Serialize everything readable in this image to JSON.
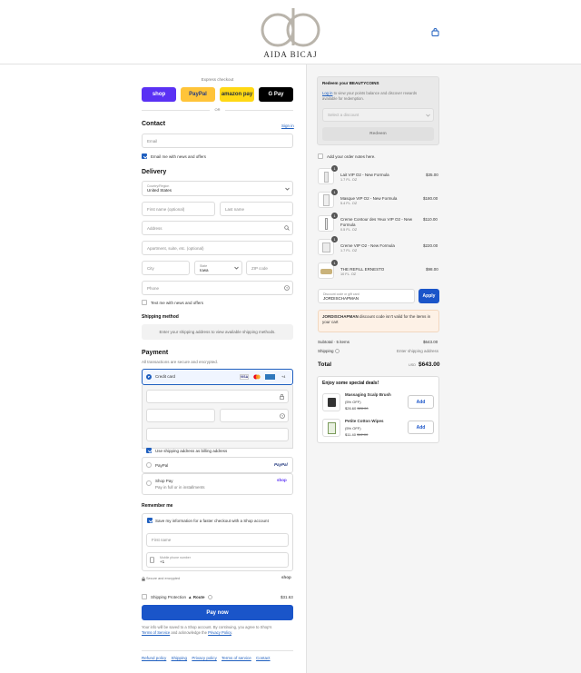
{
  "brand": {
    "name": "AIDA BICAJ"
  },
  "express": {
    "label": "Express checkout",
    "buttons": [
      {
        "name": "shop-pay",
        "label": "shop",
        "bg": "#5a31f4",
        "fg": "#ffffff"
      },
      {
        "name": "paypal",
        "label": "PayPal",
        "bg": "#ffc439",
        "fg": "#253b80"
      },
      {
        "name": "amazon-pay",
        "label": "amazon pay",
        "bg": "#ffd814",
        "fg": "#232f3e"
      },
      {
        "name": "google-pay",
        "label": "G Pay",
        "bg": "#000000",
        "fg": "#ffffff"
      }
    ],
    "or": "OR"
  },
  "contact": {
    "title": "Contact",
    "sign_in": "Sign in",
    "email_placeholder": "Email",
    "news_label": "Email me with news and offers"
  },
  "delivery": {
    "title": "Delivery",
    "country_label": "Country/Region",
    "country_value": "United States",
    "first_name": "First name (optional)",
    "last_name": "Last name",
    "address": "Address",
    "apartment": "Apartment, suite, etc. (optional)",
    "city": "City",
    "state_label": "State",
    "state_value": "Iowa",
    "zip": "ZIP code",
    "phone": "Phone",
    "text_label": "Text me with news and offers"
  },
  "shipping_method": {
    "title": "Shipping method",
    "message": "Enter your shipping address to view available shipping methods."
  },
  "payment": {
    "title": "Payment",
    "subtitle": "All transactions are secure and encrypted.",
    "credit_card": "Credit card",
    "more_cards": "+4",
    "billing_label": "Use shipping address as billing address",
    "paypal": "PayPal",
    "paypal_logo": "PayPal",
    "shop_pay": "Shop Pay",
    "shop_pay_sub": "Pay in full or in installments",
    "shop_logo": "shop"
  },
  "remember": {
    "title": "Remember me",
    "save_label": "Save my information for a faster checkout with a Shop account",
    "first_name": "First name",
    "mobile_label": "Mobile phone number",
    "mobile_value": "+1",
    "secure": "Secure and encrypted",
    "shop": "shop"
  },
  "protection": {
    "label": "Shipping Protection",
    "route": "Route",
    "price": "$31.63"
  },
  "pay_now": "Pay now",
  "legal": {
    "text1": "Your info will be saved to a Shop account. By continuing, you agree to Shop's",
    "terms": "Terms of Service",
    "text2": "and acknowledge the",
    "privacy": "Privacy Policy",
    "end": "."
  },
  "footer_links": [
    "Refund policy",
    "Shipping",
    "Privacy policy",
    "Terms of service",
    "Contact"
  ],
  "beautycoins": {
    "title": "Redeem your BEAUTYCOINS",
    "login": "Log in",
    "desc1": "to view your points balance and discover rewards",
    "desc2": "available for redemption.",
    "select": "Select a discount",
    "redeem": "Redeem"
  },
  "notes_label": "Add your order notes here.",
  "items": [
    {
      "qty": "1",
      "name": "Lait VIP O2 - New Formula",
      "size": "1.7 FL. OZ",
      "price": "$35.00"
    },
    {
      "qty": "1",
      "name": "Masque VIP O2 - New Formula",
      "size": "5.4 FL. OZ",
      "price": "$180.00"
    },
    {
      "qty": "1",
      "name": "Creme Contour des Yeux VIP O2 - New",
      "name2": "Formula",
      "size": "0.5 FL. OZ",
      "price": "$110.00"
    },
    {
      "qty": "1",
      "name": "Creme VIP O2 - New Formula",
      "size": "1.7 FL. OZ",
      "price": "$220.00"
    },
    {
      "qty": "1",
      "name": "THE REFILL ERNESTO",
      "size": "10 FL. OZ",
      "price": "$98.00"
    }
  ],
  "discount": {
    "label": "Discount code or gift card",
    "value": "JORDISCHAPMAN",
    "apply": "Apply",
    "error_code": "JORDISCHAPMAN",
    "error_text": "discount code isn't valid for the items in",
    "error_text2": "your cart"
  },
  "totals": {
    "subtotal_label": "Subtotal · 5 items",
    "subtotal": "$643.00",
    "shipping_label": "Shipping",
    "shipping_value": "Enter shipping address",
    "total_label": "Total",
    "currency": "USD",
    "total": "$643.00"
  },
  "deals": {
    "title": "Enjoy some special deals!",
    "items": [
      {
        "name": "Massaging Scalp Brush",
        "off": "(5% OFF)",
        "price": "$26.60",
        "old": "$28.00",
        "add": "Add"
      },
      {
        "name": "Petite Cotton Wipes",
        "off": "(5% OFF)",
        "price": "$11.40",
        "old": "$12.00",
        "add": "Add"
      }
    ]
  }
}
